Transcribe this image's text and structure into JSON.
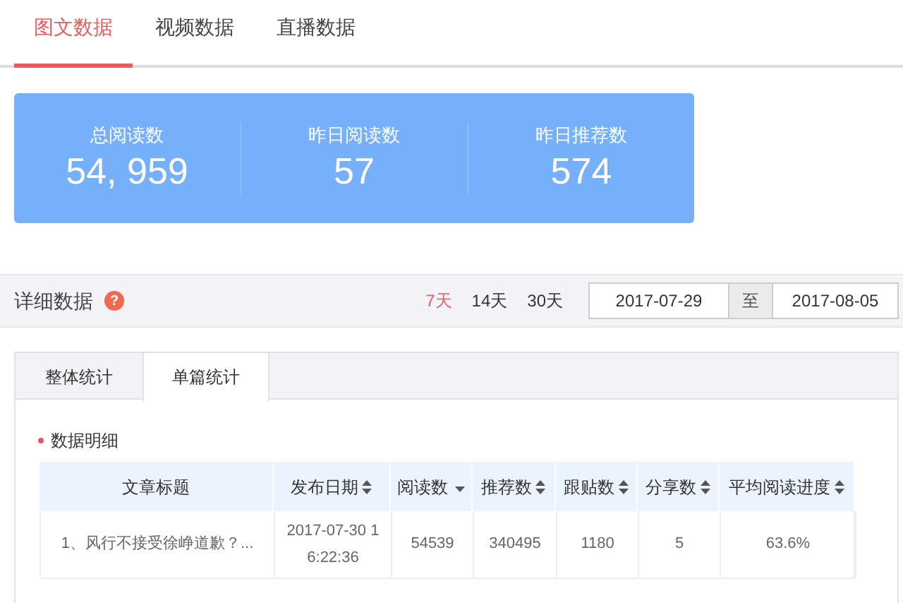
{
  "tabs": [
    {
      "label": "图文数据",
      "selected": true
    },
    {
      "label": "视频数据",
      "selected": false
    },
    {
      "label": "直播数据",
      "selected": false
    }
  ],
  "summary": [
    {
      "label": "总阅读数",
      "value": "54, 959"
    },
    {
      "label": "昨日阅读数",
      "value": "57"
    },
    {
      "label": "昨日推荐数",
      "value": "574"
    }
  ],
  "detail_bar": {
    "title": "详细数据",
    "help": "?",
    "periods": [
      {
        "label": "7天",
        "selected": true
      },
      {
        "label": "14天",
        "selected": false
      },
      {
        "label": "30天",
        "selected": false
      }
    ],
    "date_from": "2017-07-29",
    "separator": "至",
    "date_to": "2017-08-05"
  },
  "sub_tabs": [
    {
      "label": "整体统计",
      "selected": false
    },
    {
      "label": "单篇统计",
      "selected": true
    }
  ],
  "section_title": "数据明细",
  "table": {
    "columns": [
      {
        "label": "文章标题",
        "kind": "plain"
      },
      {
        "label": "发布日期",
        "kind": "sortable"
      },
      {
        "label": "阅读数",
        "kind": "sorted"
      },
      {
        "label": "推荐数",
        "kind": "sortable"
      },
      {
        "label": "跟贴数",
        "kind": "sortable"
      },
      {
        "label": "分享数",
        "kind": "sortable"
      },
      {
        "label": "平均阅读进度",
        "kind": "sortable"
      }
    ],
    "rows": [
      [
        "1、风行不接受徐峥道歉？...",
        "2017-07-30 16:22:36",
        "54539",
        "340495",
        "1180",
        "5",
        "63.6%"
      ]
    ]
  }
}
